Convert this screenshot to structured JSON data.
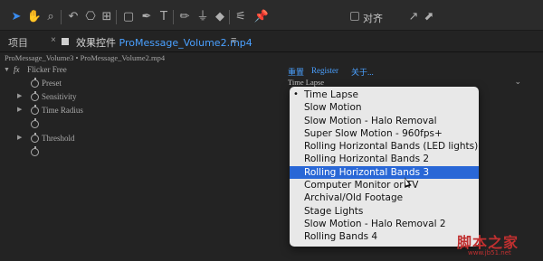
{
  "toolbar": {
    "icons": [
      "selection-arrow",
      "hand",
      "zoom",
      "rotate",
      "camera-orbit",
      "pan-behind",
      "rectangle",
      "pen",
      "type",
      "brush",
      "clone-stamp",
      "eraser",
      "roto-brush",
      "puppet-pin"
    ],
    "align_label": "对齐"
  },
  "tabs": {
    "project": "项目",
    "effect_controls_prefix": "效果控件",
    "effect_controls_file": "ProMessage_Volume2.mp4",
    "menu": "≡",
    "close": "×"
  },
  "breadcrumb": "ProMessage_Volume3 • ProMessage_Volume2.mp4",
  "effect": {
    "fx": "fx",
    "name": "Flicker Free",
    "reset": "重置",
    "register": "Register",
    "about": "关于...",
    "params": [
      {
        "label": "Preset",
        "value": "Time Lapse"
      },
      {
        "label": "Sensitivity"
      },
      {
        "label": "Time Radius"
      },
      {
        "label": ""
      },
      {
        "label": "Threshold"
      },
      {
        "label": ""
      }
    ]
  },
  "dropdown": {
    "options": [
      "Time Lapse",
      "Slow Motion",
      "Slow Motion - Halo Removal",
      "Super Slow Motion - 960fps+",
      "Rolling Horizontal Bands (LED lights)",
      "Rolling Horizontal Bands 2",
      "Rolling Horizontal Bands 3",
      "Computer Monitor or TV",
      "Archival/Old Footage",
      "Stage Lights",
      "Slow Motion - Halo Removal 2",
      "Rolling Bands 4"
    ],
    "checked": "Time Lapse",
    "highlighted": "Rolling Horizontal Bands 3"
  },
  "watermark": {
    "text": "脚本之家",
    "url": "www.jb51.net"
  },
  "colors": {
    "accent": "#2967d6",
    "link": "#4aa0ff",
    "panel": "#232323"
  }
}
